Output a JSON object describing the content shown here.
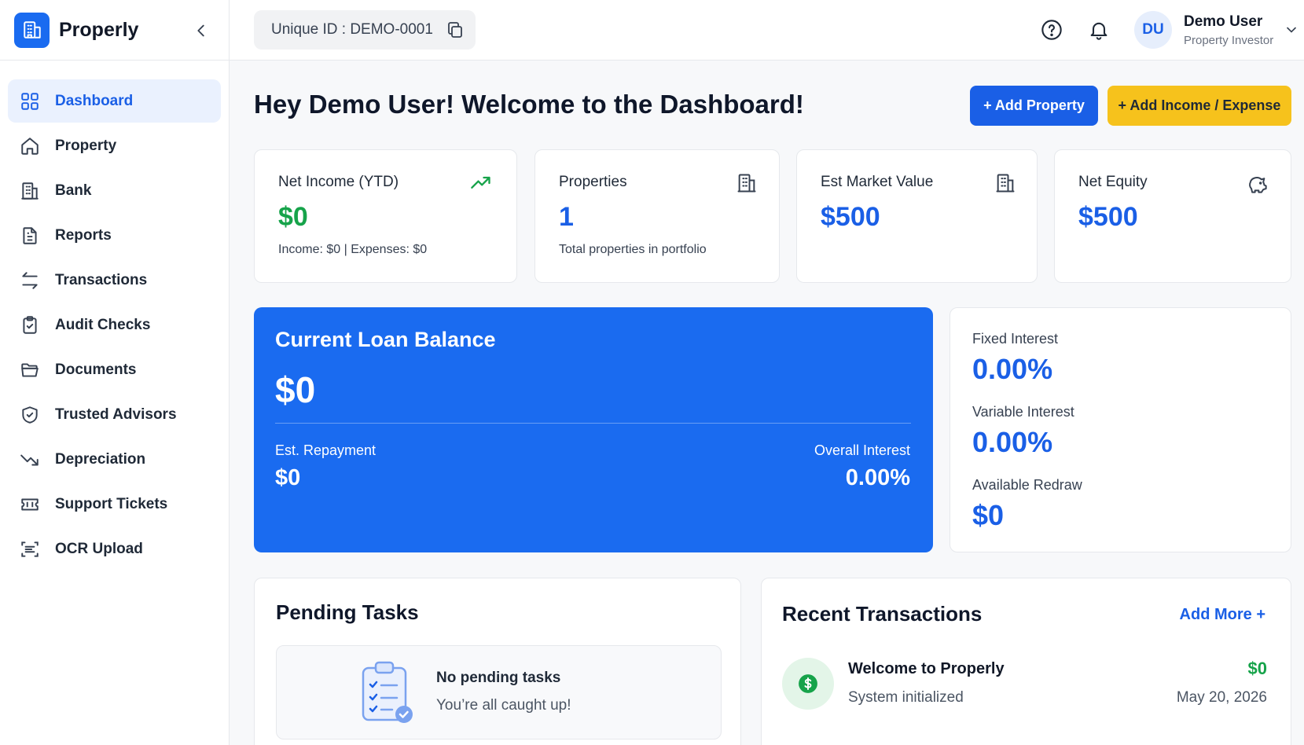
{
  "app": {
    "name": "Properly"
  },
  "sidebar": {
    "items": [
      {
        "label": "Dashboard",
        "icon": "grid-icon",
        "active": true
      },
      {
        "label": "Property",
        "icon": "home-icon"
      },
      {
        "label": "Bank",
        "icon": "building-icon"
      },
      {
        "label": "Reports",
        "icon": "document-icon"
      },
      {
        "label": "Transactions",
        "icon": "arrows-icon"
      },
      {
        "label": "Audit Checks",
        "icon": "clipboard-check-icon"
      },
      {
        "label": "Documents",
        "icon": "folder-icon"
      },
      {
        "label": "Trusted Advisors",
        "icon": "shield-check-icon"
      },
      {
        "label": "Depreciation",
        "icon": "trend-down-icon"
      },
      {
        "label": "Support Tickets",
        "icon": "ticket-icon"
      },
      {
        "label": "OCR Upload",
        "icon": "scan-icon"
      }
    ]
  },
  "topbar": {
    "unique_id": "Unique ID : DEMO-0001",
    "user": {
      "initials": "DU",
      "name": "Demo User",
      "role": "Property Investor"
    }
  },
  "main": {
    "welcome": "Hey Demo User! Welcome to the Dashboard!",
    "add_property_label": "+ Add Property",
    "add_income_label": "+ Add Income / Expense",
    "stats": [
      {
        "label": "Net Income (YTD)",
        "value": "$0",
        "sub": "Income: $0 | Expenses: $0",
        "icon": "trend-up-icon",
        "color": "#16a34a"
      },
      {
        "label": "Properties",
        "value": "1",
        "sub": "Total properties in portfolio",
        "icon": "building-icon",
        "color": "#1a5fe6"
      },
      {
        "label": "Est Market Value",
        "value": "$500",
        "icon": "building-icon",
        "color": "#1a5fe6"
      },
      {
        "label": "Net Equity",
        "value": "$500",
        "icon": "piggy-bank-icon",
        "color": "#1a5fe6"
      }
    ],
    "loan": {
      "title": "Current Loan Balance",
      "value": "$0",
      "repayment_label": "Est. Repayment",
      "repayment_value": "$0",
      "interest_label": "Overall Interest",
      "interest_value": "0.00%"
    },
    "rates": {
      "fixed_label": "Fixed Interest",
      "fixed_value": "0.00%",
      "variable_label": "Variable Interest",
      "variable_value": "0.00%",
      "redraw_label": "Available Redraw",
      "redraw_value": "$0"
    },
    "pending": {
      "title": "Pending Tasks",
      "empty_title": "No pending tasks",
      "empty_sub": "You’re all caught up!"
    },
    "recent": {
      "title": "Recent Transactions",
      "add_more": "Add More +",
      "items": [
        {
          "title": "Welcome to Properly",
          "sub": "System initialized",
          "amount": "$0",
          "date": "May 20, 2026"
        }
      ]
    }
  },
  "colors": {
    "primary": "#1a5fe6",
    "accent": "#f6c21c",
    "positive": "#16a34a"
  }
}
